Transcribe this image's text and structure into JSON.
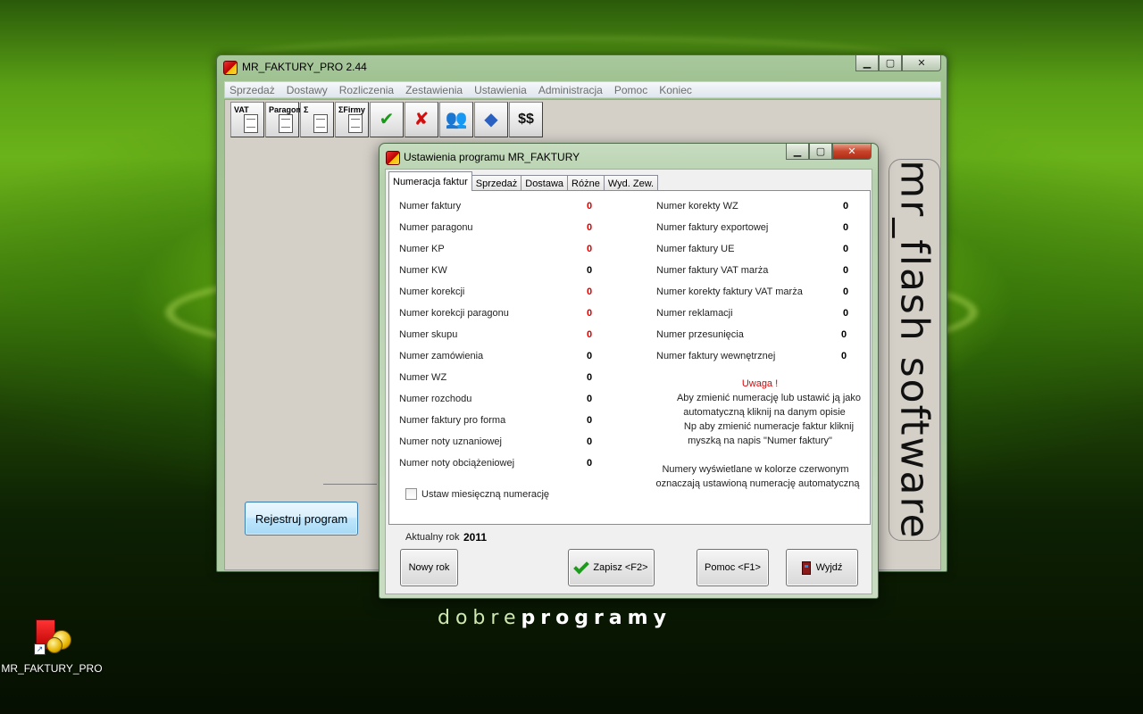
{
  "main_window": {
    "title": "MR_FAKTURY_PRO 2.44",
    "menu": [
      "Sprzedaż",
      "Dostawy",
      "Rozliczenia",
      "Zestawienia",
      "Ustawienia",
      "Administracja",
      "Pomoc",
      "Koniec"
    ],
    "toolbar": {
      "vat_label": "VAT",
      "paragon_label": "Paragon",
      "sigma_label": "Σ",
      "firmy_label": "ΣFirmy",
      "money_label": "$$"
    },
    "register_button": "Rejestruj program"
  },
  "brand": "mr_flash software",
  "dialog": {
    "title": "Ustawienia programu MR_FAKTURY",
    "tabs": [
      "Numeracja faktur",
      "Sprzedaż",
      "Dostawa",
      "Różne",
      "Wyd. Zew."
    ],
    "left_rows": [
      {
        "label": "Numer faktury",
        "value": "0",
        "auto": true
      },
      {
        "label": "Numer paragonu",
        "value": "0",
        "auto": true
      },
      {
        "label": "Numer KP",
        "value": "0",
        "auto": true
      },
      {
        "label": "Numer KW",
        "value": "0",
        "auto": false
      },
      {
        "label": "Numer korekcji",
        "value": "0",
        "auto": true
      },
      {
        "label": "Numer korekcji paragonu",
        "value": "0",
        "auto": true
      },
      {
        "label": "Numer skupu",
        "value": "0",
        "auto": true
      },
      {
        "label": "Numer zamówienia",
        "value": "0",
        "auto": false
      },
      {
        "label": "Numer WZ",
        "value": "0",
        "auto": false
      },
      {
        "label": "Numer rozchodu",
        "value": "0",
        "auto": false
      },
      {
        "label": "Numer faktury pro forma",
        "value": "0",
        "auto": false
      },
      {
        "label": "Numer noty uznaniowej",
        "value": "0",
        "auto": false
      },
      {
        "label": "Numer noty obciążeniowej",
        "value": "0",
        "auto": false
      }
    ],
    "right_rows": [
      {
        "label": "Numer korekty WZ",
        "value": "0",
        "auto": false
      },
      {
        "label": "Numer faktury exportowej",
        "value": "0",
        "auto": false
      },
      {
        "label": "Numer faktury UE",
        "value": "0",
        "auto": false
      },
      {
        "label": "Numer faktury VAT marża",
        "value": "0",
        "auto": false
      },
      {
        "label": "Numer korekty faktury VAT marża",
        "value": "0",
        "auto": false
      },
      {
        "label": "Numer reklamacji",
        "value": "0",
        "auto": false
      },
      {
        "label": "Numer przesunięcia",
        "value": "0",
        "auto": false
      },
      {
        "label": "Numer faktury wewnętrznej",
        "value": "0",
        "auto": false
      }
    ],
    "notice": {
      "title": "Uwaga !",
      "line1": "Aby zmienić numerację lub ustawić ją jako",
      "line2": "automatyczną kliknij na danym opisie",
      "line3": "Np aby zmienić numeracje faktur kliknij",
      "line4": "myszką na napis \"Numer faktury\"",
      "line5": "Numery wyświetlane w kolorze czerwonym",
      "line6": "oznaczają ustawioną numerację automatyczną"
    },
    "monthly_checkbox": {
      "label": "Ustaw miesięczną numerację",
      "checked": false
    },
    "year_label": "Aktualny rok",
    "year_value": "2011",
    "buttons": {
      "new_year": "Nowy rok",
      "save": "Zapisz <F2>",
      "help": "Pomoc <F1>",
      "exit": "Wyjdź"
    }
  },
  "desktop": {
    "watermark_light": "dobre",
    "watermark_bold": "programy",
    "shortcut_label": "MR_FAKTURY_PRO"
  },
  "colors": {
    "auto_number": "#e00000",
    "normal_number": "#000000",
    "window_frame": "#a8c89d"
  }
}
